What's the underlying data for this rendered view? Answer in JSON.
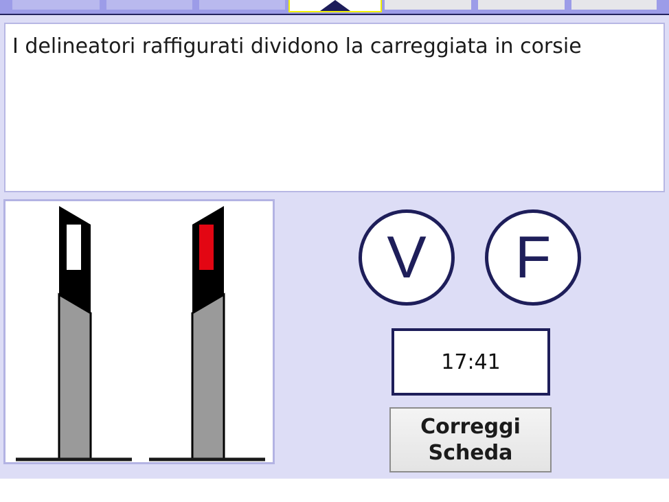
{
  "question": {
    "text": "I delineatori raffigurati dividono la carreggiata in corsie"
  },
  "answers": {
    "true_label": "V",
    "false_label": "F"
  },
  "timer": {
    "value": "17:41"
  },
  "actions": {
    "correggi_line1": "Correggi",
    "correggi_line2": "Scheda"
  },
  "icons": {
    "current_question_marker": "triangle-up-icon"
  },
  "colors": {
    "background": "#ddddf6",
    "accent": "#1e1e5a",
    "highlight": "#f0f000",
    "delineator_red": "#e30613",
    "delineator_gray": "#9a9a9a"
  }
}
